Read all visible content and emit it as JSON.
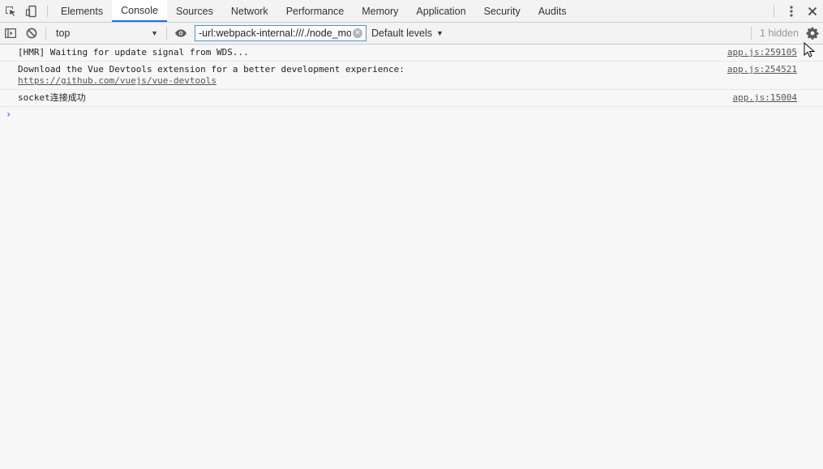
{
  "tabs": [
    {
      "label": "Elements",
      "active": false
    },
    {
      "label": "Console",
      "active": true
    },
    {
      "label": "Sources",
      "active": false
    },
    {
      "label": "Network",
      "active": false
    },
    {
      "label": "Performance",
      "active": false
    },
    {
      "label": "Memory",
      "active": false
    },
    {
      "label": "Application",
      "active": false
    },
    {
      "label": "Security",
      "active": false
    },
    {
      "label": "Audits",
      "active": false
    }
  ],
  "toolbar": {
    "context": "top",
    "filter_value": "-url:webpack-internal:///./node_modules",
    "levels_label": "Default levels",
    "hidden_label": "1 hidden"
  },
  "messages": [
    {
      "text": "[HMR] Waiting for update signal from WDS...",
      "source": "app.js:259105"
    },
    {
      "text": "Download the Vue Devtools extension for a better development experience:",
      "link": "https://github.com/vuejs/vue-devtools",
      "source": "app.js:254521"
    },
    {
      "text": "socket连接成功",
      "source": "app.js:15004"
    }
  ],
  "prompt_symbol": "›",
  "colors": {
    "accent": "#1a73e8",
    "filter_border": "#4a90d9",
    "prompt": "#367cf1"
  }
}
